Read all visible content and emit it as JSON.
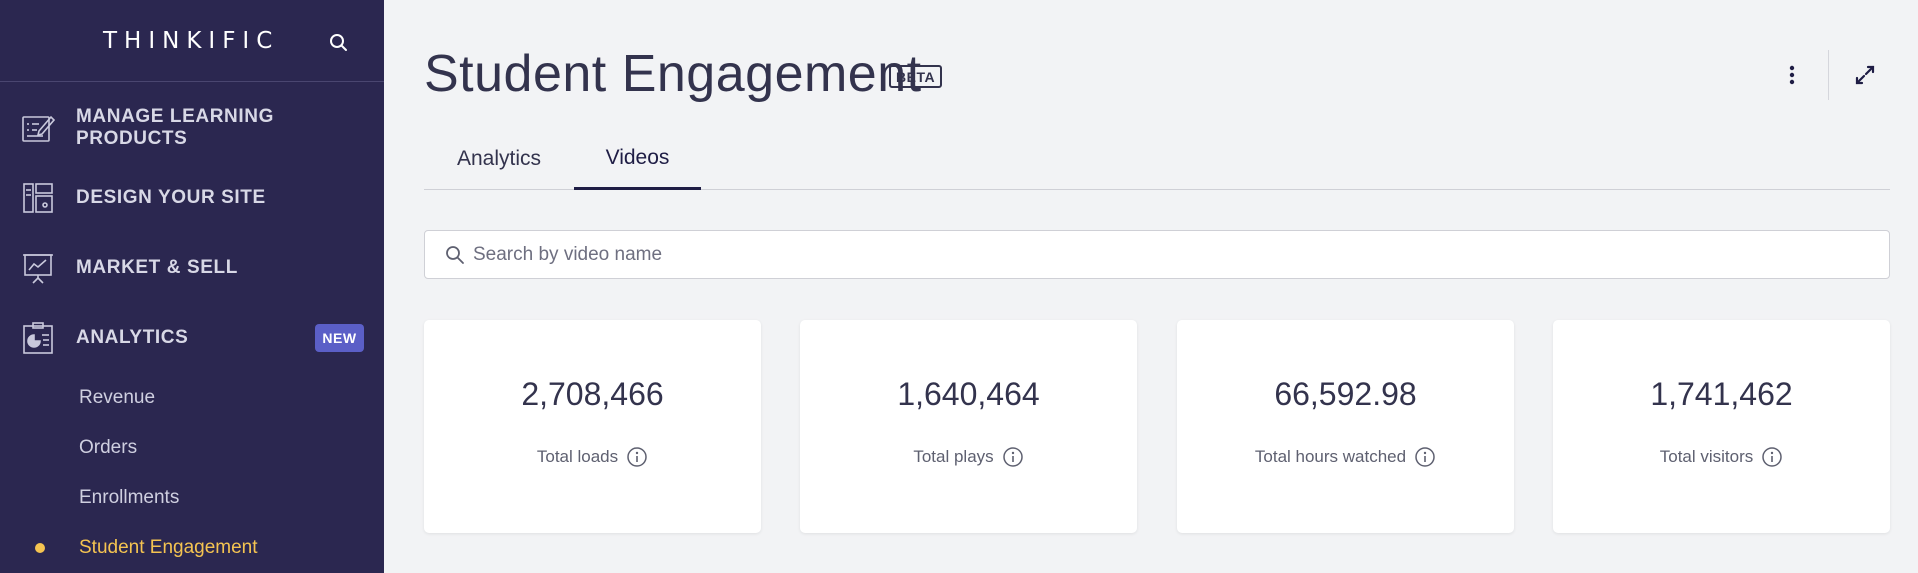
{
  "sidebar": {
    "logo": "THINKIFIC",
    "search_icon": "search-icon",
    "nav": [
      {
        "label": "MANAGE LEARNING PRODUCTS",
        "icon": "edit-list-icon"
      },
      {
        "label": "DESIGN YOUR SITE",
        "icon": "layout-icon"
      },
      {
        "label": "MARKET & SELL",
        "icon": "presentation-chart-icon"
      },
      {
        "label": "ANALYTICS",
        "icon": "clipboard-pie-icon",
        "badge": "NEW"
      }
    ],
    "sub_items": [
      {
        "label": "Revenue",
        "active": false
      },
      {
        "label": "Orders",
        "active": false
      },
      {
        "label": "Enrollments",
        "active": false
      },
      {
        "label": "Student Engagement",
        "active": true
      }
    ],
    "accent_color": "#f5c451",
    "badge_color": "#5b5fc7",
    "background": "#2b2750"
  },
  "header": {
    "title": "Student Engagement",
    "beta_badge": "BETA",
    "more_icon": "kebab-menu-icon",
    "expand_icon": "expand-icon"
  },
  "tabs": [
    {
      "label": "Analytics",
      "active": false
    },
    {
      "label": "Videos",
      "active": true
    }
  ],
  "search": {
    "placeholder": "Search by video name",
    "value": ""
  },
  "stats": [
    {
      "value": "2,708,466",
      "label": "Total loads"
    },
    {
      "value": "1,640,464",
      "label": "Total plays"
    },
    {
      "value": "66,592.98",
      "label": "Total hours watched"
    },
    {
      "value": "1,741,462",
      "label": "Total visitors"
    }
  ]
}
